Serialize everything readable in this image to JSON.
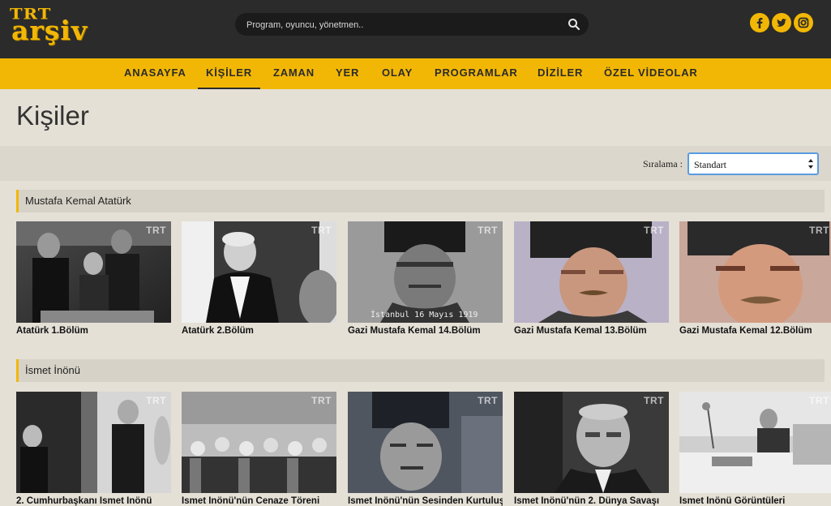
{
  "header": {
    "logo_line1": "TRT",
    "logo_line2": "arşiv",
    "search_placeholder": "Program, oyuncu, yönetmen..",
    "social": [
      "facebook-icon",
      "twitter-icon",
      "instagram-icon"
    ]
  },
  "nav": {
    "items": [
      {
        "label": "ANASAYFA"
      },
      {
        "label": "KİŞİLER"
      },
      {
        "label": "ZAMAN"
      },
      {
        "label": "YER"
      },
      {
        "label": "OLAY"
      },
      {
        "label": "PROGRAMLAR"
      },
      {
        "label": "DİZİLER"
      },
      {
        "label": "ÖZEL VİDEOLAR"
      }
    ],
    "active": "KİŞİLER"
  },
  "page": {
    "title": "Kişiler",
    "sort_label": "Sıralama :",
    "sort_value": "Standart"
  },
  "sections": [
    {
      "title": "Mustafa Kemal Atatürk",
      "cards": [
        {
          "title": "Atatürk 1.Bölüm",
          "badge": "TRT"
        },
        {
          "title": "Atatürk 2.Bölüm",
          "badge": "TRT"
        },
        {
          "title": "Gazi Mustafa Kemal 14.Bölüm",
          "badge": "TRT",
          "stamp": "İstanbul 16 Mayıs 1919"
        },
        {
          "title": "Gazi Mustafa Kemal 13.Bölüm",
          "badge": "TRT"
        },
        {
          "title": "Gazi Mustafa Kemal 12.Bölüm",
          "badge": "TRT"
        }
      ]
    },
    {
      "title": "İsmet İnönü",
      "cards": [
        {
          "title": "2. Cumhurbaşkanı İsmet İnönü",
          "badge": "TRT"
        },
        {
          "title": "İsmet İnönü'nün Cenaze Töreni",
          "badge": "TRT"
        },
        {
          "title": "İsmet İnönü'nün Sesinden Kurtuluş",
          "badge": "TRT"
        },
        {
          "title": "İsmet İnönü'nün 2. Dünya Savaşı",
          "badge": "TRT"
        },
        {
          "title": "İsmet İnönü Görüntüleri",
          "badge": "TRT"
        }
      ]
    }
  ]
}
